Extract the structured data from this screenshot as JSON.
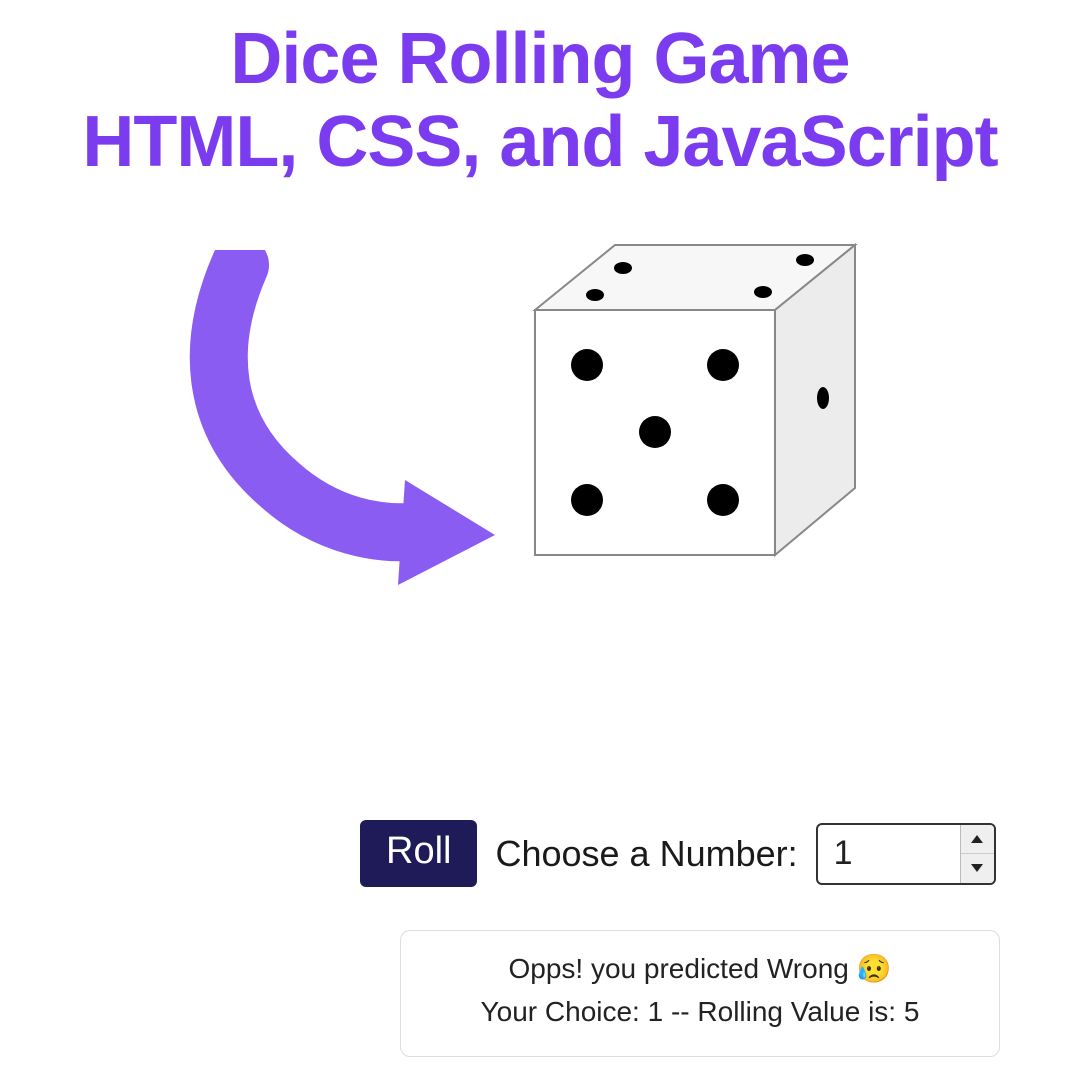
{
  "title": {
    "line1": "Dice Rolling Game",
    "line2": "HTML, CSS, and JavaScript"
  },
  "dice": {
    "front_face_value": 5,
    "top_face_value": 4,
    "right_face_value": 1
  },
  "controls": {
    "roll_button_label": "Roll",
    "choose_label": "Choose a Number:",
    "number_value": "1"
  },
  "game_state": {
    "user_choice": 1,
    "rolled_value": 5,
    "is_correct": false
  },
  "result": {
    "line1": "Opps! you predicted Wrong 😥",
    "line2": "Your Choice: 1 -- Rolling Value is: 5"
  },
  "colors": {
    "accent_purple": "#7b3cf0",
    "button_bg": "#1f1b58"
  }
}
